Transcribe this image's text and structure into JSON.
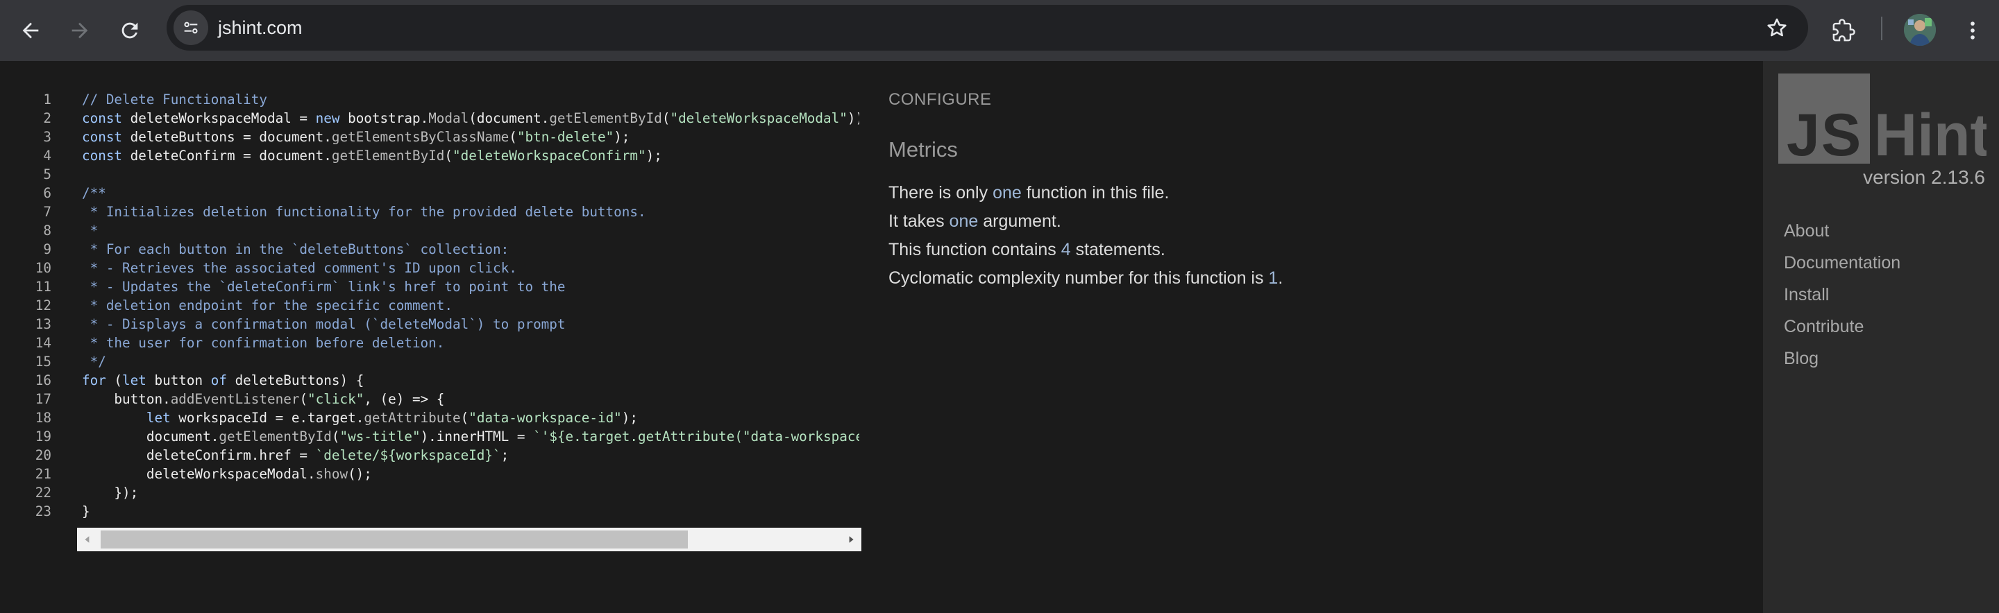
{
  "browser": {
    "url": "jshint.com",
    "icons": [
      "back-icon",
      "forward-icon",
      "reload-icon",
      "site-info-icon",
      "bookmark-star-icon",
      "extensions-icon",
      "profile-avatar",
      "more-menu-icon"
    ]
  },
  "editor": {
    "lines": [
      {
        "n": "1",
        "html": "<span style='color:#8aa8d6'>// Delete Functionality</span>"
      },
      {
        "n": "2",
        "html": "<span style='color:#9fc8ff'>const</span> deleteWorkspaceModal = <span style='color:#9fc8ff'>new</span> bootstrap.<span style='color:#bbbbbb'>Modal</span>(document.<span style='color:#bbbbbb'>getElementById</span>(<span style='color:#b5e3c0'>\"deleteWorkspaceModal\"</span>));"
      },
      {
        "n": "3",
        "html": "<span style='color:#9fc8ff'>const</span> deleteButtons = document.<span style='color:#bbbbbb'>getElementsByClassName</span>(<span style='color:#b5e3c0'>\"btn-delete\"</span>);"
      },
      {
        "n": "4",
        "html": "<span style='color:#9fc8ff'>const</span> deleteConfirm = document.<span style='color:#bbbbbb'>getElementById</span>(<span style='color:#b5e3c0'>\"deleteWorkspaceConfirm\"</span>);"
      },
      {
        "n": "5",
        "html": ""
      },
      {
        "n": "6",
        "html": "<span style='color:#8aa8d6'>/**</span>"
      },
      {
        "n": "7",
        "html": "<span style='color:#8aa8d6'> * Initializes deletion functionality for the provided delete buttons.</span>"
      },
      {
        "n": "8",
        "html": "<span style='color:#8aa8d6'> *</span>"
      },
      {
        "n": "9",
        "html": "<span style='color:#8aa8d6'> * For each button in the `deleteButtons` collection:</span>"
      },
      {
        "n": "10",
        "html": "<span style='color:#8aa8d6'> * - Retrieves the associated comment's ID upon click.</span>"
      },
      {
        "n": "11",
        "html": "<span style='color:#8aa8d6'> * - Updates the `deleteConfirm` link's href to point to the</span>"
      },
      {
        "n": "12",
        "html": "<span style='color:#8aa8d6'> * deletion endpoint for the specific comment.</span>"
      },
      {
        "n": "13",
        "html": "<span style='color:#8aa8d6'> * - Displays a confirmation modal (`deleteModal`) to prompt</span>"
      },
      {
        "n": "14",
        "html": "<span style='color:#8aa8d6'> * the user for confirmation before deletion.</span>"
      },
      {
        "n": "15",
        "html": "<span style='color:#8aa8d6'> */</span>"
      },
      {
        "n": "16",
        "html": "<span style='color:#9fc8ff'>for</span> (<span style='color:#9fc8ff'>let</span> button <span style='color:#9fc8ff'>of</span> deleteButtons) {"
      },
      {
        "n": "17",
        "html": "    button.<span style='color:#bbbbbb'>addEventListener</span>(<span style='color:#b5e3c0'>\"click\"</span>, (e) =&gt; {"
      },
      {
        "n": "18",
        "html": "        <span style='color:#9fc8ff'>let</span> workspaceId = e.target.<span style='color:#bbbbbb'>getAttribute</span>(<span style='color:#b5e3c0'>\"data-workspace-id\"</span>);"
      },
      {
        "n": "19",
        "html": "        document.<span style='color:#bbbbbb'>getElementById</span>(<span style='color:#b5e3c0'>\"ws-title\"</span>).innerHTML = <span style='color:#b5e3c0'>`'${e.target.getAttribute(\"data-workspace-title\")}'`</span>;"
      },
      {
        "n": "20",
        "html": "        deleteConfirm.href = <span style='color:#b5e3c0'>`delete/${workspaceId}`</span>;"
      },
      {
        "n": "21",
        "html": "        deleteWorkspaceModal.<span style='color:#bbbbbb'>show</span>();"
      },
      {
        "n": "22",
        "html": "    });"
      },
      {
        "n": "23",
        "html": "}"
      }
    ]
  },
  "report": {
    "configure": "CONFIGURE",
    "metrics_title": "Metrics",
    "metrics": [
      [
        "There is only ",
        "one",
        " function in this file."
      ],
      [
        "It takes ",
        "one",
        " argument."
      ],
      [
        "This function contains ",
        "4",
        " statements."
      ],
      [
        "Cyclomatic complexity number for this function is ",
        "1",
        "."
      ]
    ]
  },
  "sidebar": {
    "logo_text_1": "JS",
    "logo_text_2": "Hint",
    "version": "version 2.13.6",
    "nav": [
      "About",
      "Documentation",
      "Install",
      "Contribute",
      "Blog"
    ]
  }
}
